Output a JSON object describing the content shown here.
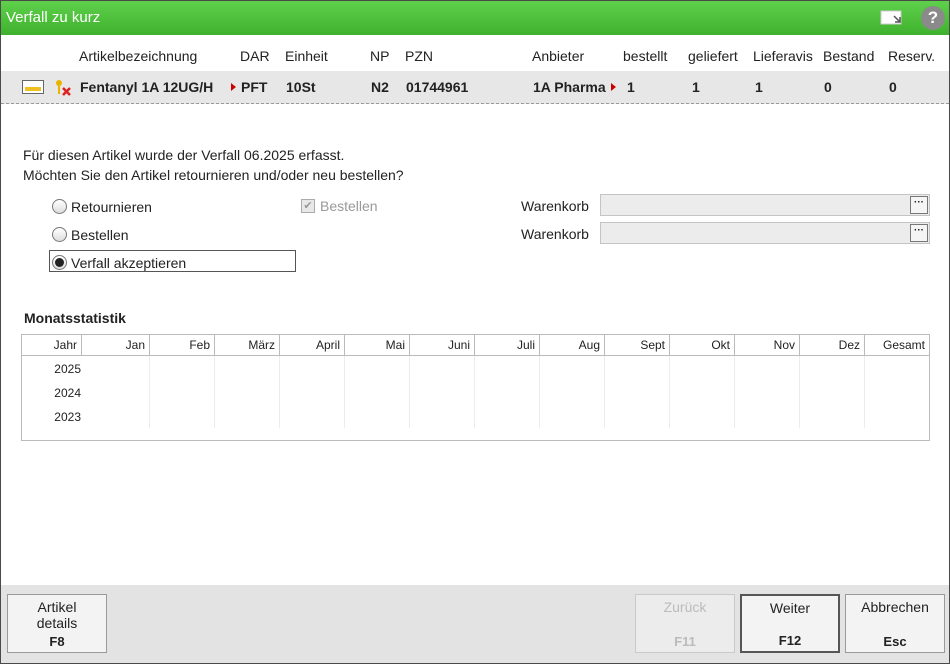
{
  "window": {
    "title": "Verfall zu kurz",
    "help_label": "?"
  },
  "columns": [
    "Artikelbezeichnung",
    "DAR",
    "Einheit",
    "NP",
    "PZN",
    "Anbieter",
    "bestellt",
    "geliefert",
    "Lieferavis",
    "Bestand",
    "Reserv."
  ],
  "article": {
    "name": "Fentanyl 1A 12UG/H",
    "dar": "PFT",
    "einheit": "10St",
    "np": "N2",
    "pzn": "01744961",
    "anbieter": "1A Pharma",
    "bestellt": "1",
    "geliefert": "1",
    "lieferavis": "1",
    "bestand": "0",
    "reserv": "0"
  },
  "message": {
    "line1": "Für diesen Artikel wurde der Verfall 06.2025 erfasst.",
    "line2": "Möchten Sie den Artikel retournieren und/oder neu bestellen?"
  },
  "options": {
    "retournieren": "Retournieren",
    "bestellen": "Bestellen",
    "verfall": "Verfall akzeptieren",
    "bestellen_check": "Bestellen",
    "selected": "Verfall akzeptieren",
    "bestellen_checked": true
  },
  "warenkorb": {
    "label1": "Warenkorb",
    "value1": "",
    "label2": "Warenkorb",
    "value2": "",
    "browse": "···"
  },
  "stats": {
    "title": "Monatsstatistik",
    "headers": [
      "Jahr",
      "Jan",
      "Feb",
      "März",
      "April",
      "Mai",
      "Juni",
      "Juli",
      "Aug",
      "Sept",
      "Okt",
      "Nov",
      "Dez",
      "Gesamt"
    ],
    "years": [
      "2025",
      "2024",
      "2023"
    ]
  },
  "buttons": {
    "details": {
      "line1": "Artikel",
      "line2": "details",
      "key": "F8"
    },
    "zurueck": {
      "line1": "Zurück",
      "key": "F11"
    },
    "weiter": {
      "line1": "Weiter",
      "key": "F12"
    },
    "abbrechen": {
      "line1": "Abbrechen",
      "key": "Esc"
    }
  },
  "colors": {
    "titlebar": "#4cc23a",
    "row_bg": "#e7e7e7",
    "footer_bg": "#e3e3e3"
  }
}
